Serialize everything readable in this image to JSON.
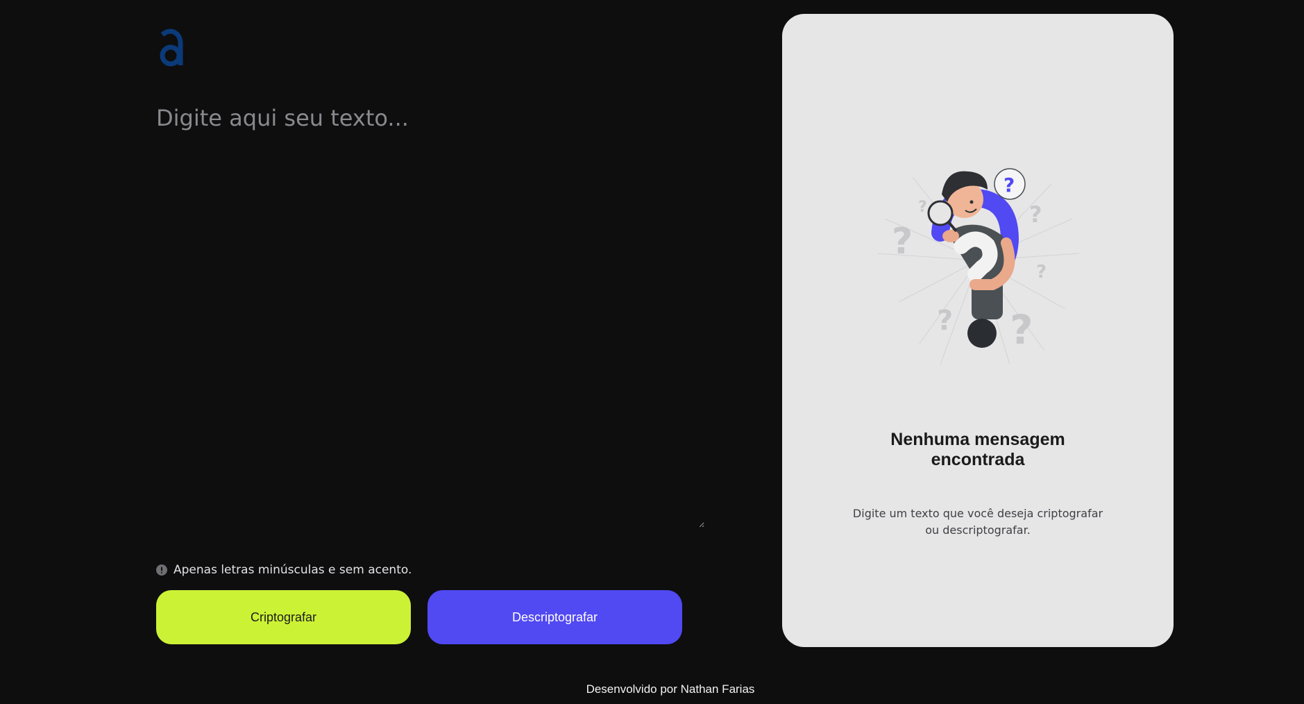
{
  "brand": {
    "logo_letter": "a",
    "logo_color": "#0b3a78"
  },
  "input": {
    "placeholder": "Digite aqui seu texto...",
    "value": ""
  },
  "hint": {
    "icon": "info-icon",
    "text": "Apenas letras minúsculas e sem acento."
  },
  "actions": {
    "encrypt_label": "Criptografar",
    "decrypt_label": "Descriptografar"
  },
  "result": {
    "illustration": "person-with-magnifier-question-mark",
    "title": "Nenhuma mensagem encontrada",
    "description": "Digite um texto que você deseja criptografar ou descriptografar."
  },
  "footer": {
    "credit": "Desenvolvido por Nathan Farias"
  },
  "colors": {
    "background": "#0e0e0f",
    "card": "#e6e6e7",
    "encrypt_button": "#ccf236",
    "decrypt_button": "#5149f2",
    "accent_purple": "#5149f2"
  }
}
